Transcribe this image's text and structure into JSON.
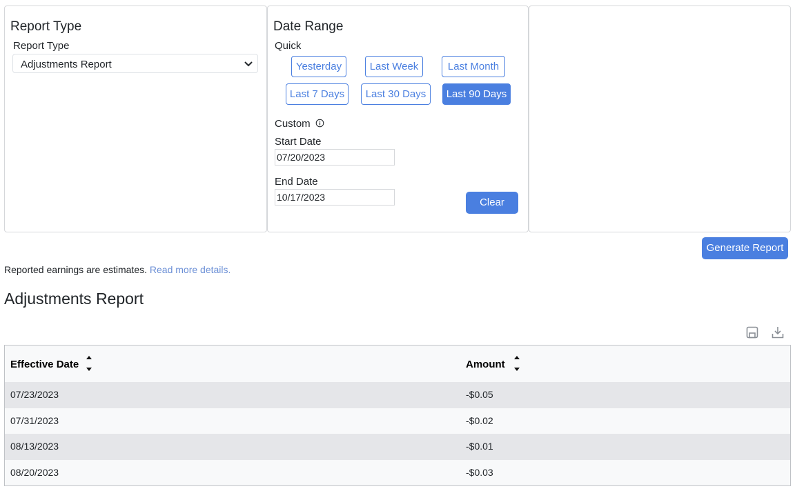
{
  "report_type_panel": {
    "title": "Report Type",
    "select_label": "Report Type",
    "selected": "Adjustments Report"
  },
  "date_range_panel": {
    "title": "Date Range",
    "quick_label": "Quick",
    "quick_buttons": [
      "Yesterday",
      "Last Week",
      "Last Month",
      "Last 7 Days",
      "Last 30 Days",
      "Last 90 Days"
    ],
    "custom_label": "Custom",
    "start_label": "Start Date",
    "start_value": "07/20/2023",
    "end_label": "End Date",
    "end_value": "10/17/2023",
    "clear_label": "Clear"
  },
  "generate_label": "Generate Report",
  "notice": {
    "text": "Reported earnings are estimates. ",
    "link": "Read more details."
  },
  "report_title": "Adjustments Report",
  "table": {
    "headers": [
      "Effective Date",
      "Amount"
    ],
    "rows": [
      [
        "07/23/2023",
        "-$0.05"
      ],
      [
        "07/31/2023",
        "-$0.02"
      ],
      [
        "08/13/2023",
        "-$0.01"
      ],
      [
        "08/20/2023",
        "-$0.03"
      ]
    ]
  },
  "colors": {
    "accent": "#4a7fe0",
    "link": "#6b8fd6",
    "row_shade": "#e5e6e9"
  }
}
